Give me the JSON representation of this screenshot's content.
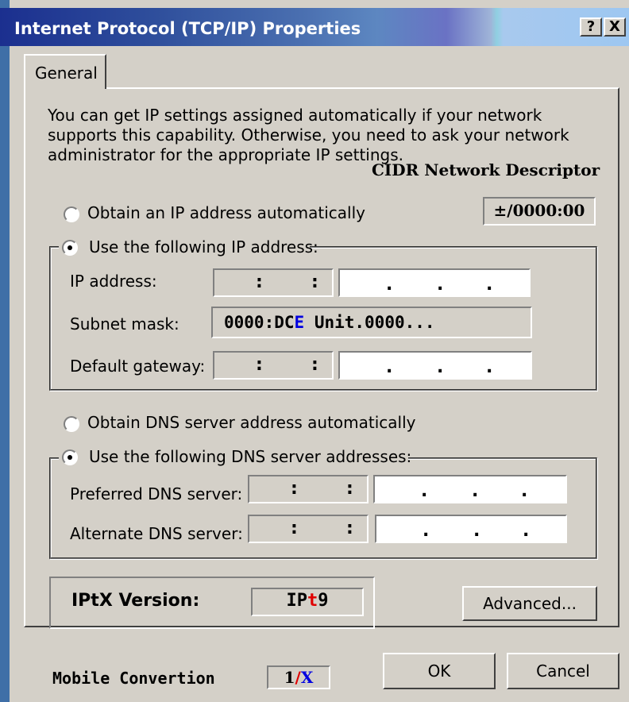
{
  "window": {
    "title": "Internet Protocol (TCP/IP) Properties",
    "help_button": "?",
    "close_button": "X"
  },
  "tabs": [
    {
      "label": "General",
      "active": true
    }
  ],
  "intro_text": "You can get IP settings assigned automatically if your network supports this capability. Otherwise, you need to ask your network administrator for the appropriate IP settings.",
  "cidr": {
    "title": "CIDR Network Descriptor",
    "value": "±/0000:00"
  },
  "ip": {
    "auto_label": "Obtain an IP address automatically",
    "manual_label": "Use the following IP address:",
    "selected": "manual",
    "ip_address_label": "IP address:",
    "subnet_mask_label": "Subnet mask:",
    "default_gateway_label": "Default gateway:",
    "ipv6_separator": ":",
    "ipv4_dots": ".",
    "subnet_value_a": "0000:DC",
    "subnet_value_b": "E",
    "subnet_value_c": " Unit.0000..."
  },
  "dns": {
    "auto_label": "Obtain DNS server address automatically",
    "manual_label": "Use the following DNS server addresses:",
    "selected": "manual",
    "preferred_label": "Preferred DNS server:",
    "alternate_label": "Alternate DNS server:"
  },
  "version": {
    "label": "IPtX Version:",
    "value_a": "IP",
    "value_b": "t",
    "value_c": "9"
  },
  "mobile": {
    "label": "Mobile Convertion",
    "value_a": "1",
    "value_b": "/",
    "value_c": "X"
  },
  "buttons": {
    "advanced": "Advanced...",
    "ok": "OK",
    "cancel": "Cancel"
  },
  "colors": {
    "accent_red": "#e00000",
    "accent_blue": "#0000e0"
  }
}
